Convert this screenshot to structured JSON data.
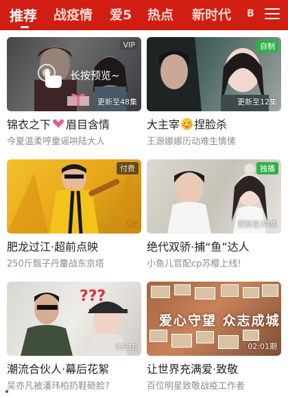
{
  "tabs": [
    {
      "label": "推荐",
      "active": true
    },
    {
      "label": "战疫情"
    },
    {
      "label": "爱5"
    },
    {
      "label": "热点"
    },
    {
      "label": "新时代"
    },
    {
      "label": "B"
    }
  ],
  "colors": {
    "topbar": "#d31f14",
    "badge_green": "#2fb14a",
    "badge_orange": "#f28b1d"
  },
  "cards": [
    {
      "badge": "VIP",
      "overlay_hint": "长按预览~",
      "episode": "更新至48集",
      "title_a": "锦衣之下",
      "title_b": "眉目含情",
      "title_icon": "heart-gift-icon",
      "subtitle": "今夏温柔哼童谣哄陆大人"
    },
    {
      "badge": "自制",
      "episode": "更新至12集",
      "title_a": "大主宰",
      "title_b": "捏脸杀",
      "title_icon": "blushing-face-icon",
      "subtitle": "王源娜娜历动难生情愫"
    },
    {
      "badge": "付费",
      "episode": "7.6",
      "title": "肥龙过江·超前点映",
      "subtitle": "250斤甄子丹鏖战东京塔"
    },
    {
      "badge": "独播",
      "episode": "更新至24集",
      "title": "绝代双骄·捕“鱼”达人",
      "subtitle": "小鱼儿官配cp苏樱上线!"
    },
    {
      "episode": "03:18",
      "title": "潮流合伙人·幕后花絮",
      "subtitle": "吴亦凡被潘玮柏扔鞋砸脸?"
    },
    {
      "episode": "02:01期",
      "banner": "爱心守望 众志成城",
      "title": "让世界充满爱·致敬",
      "subtitle": "百位明星致敬战疫工作者"
    }
  ]
}
